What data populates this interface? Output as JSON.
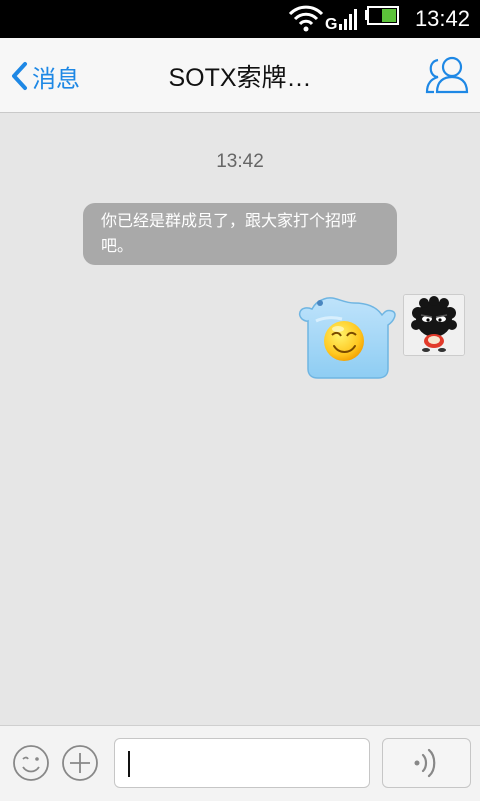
{
  "status_bar": {
    "time": "13:42",
    "network_label": "G",
    "icons": [
      "wifi-icon",
      "signal-icon",
      "battery-icon"
    ]
  },
  "nav": {
    "back_label": "消息",
    "title": "SOTX索牌…",
    "members_icon": "group-members-icon",
    "accent_color": "#1e88e5"
  },
  "chat": {
    "timestamp": "13:42",
    "system_message": "你已经是群成员了，跟大家打个招呼吧。",
    "messages": [
      {
        "sender": "self",
        "type": "sticker",
        "sticker_icon": "smiling-face-sticker",
        "avatar_icon": "black-fuzzball-avatar"
      }
    ]
  },
  "input_bar": {
    "emoji_icon": "emoji-face-icon",
    "plus_icon": "plus-circle-icon",
    "text_value": "",
    "voice_icon": "voice-wave-icon"
  }
}
